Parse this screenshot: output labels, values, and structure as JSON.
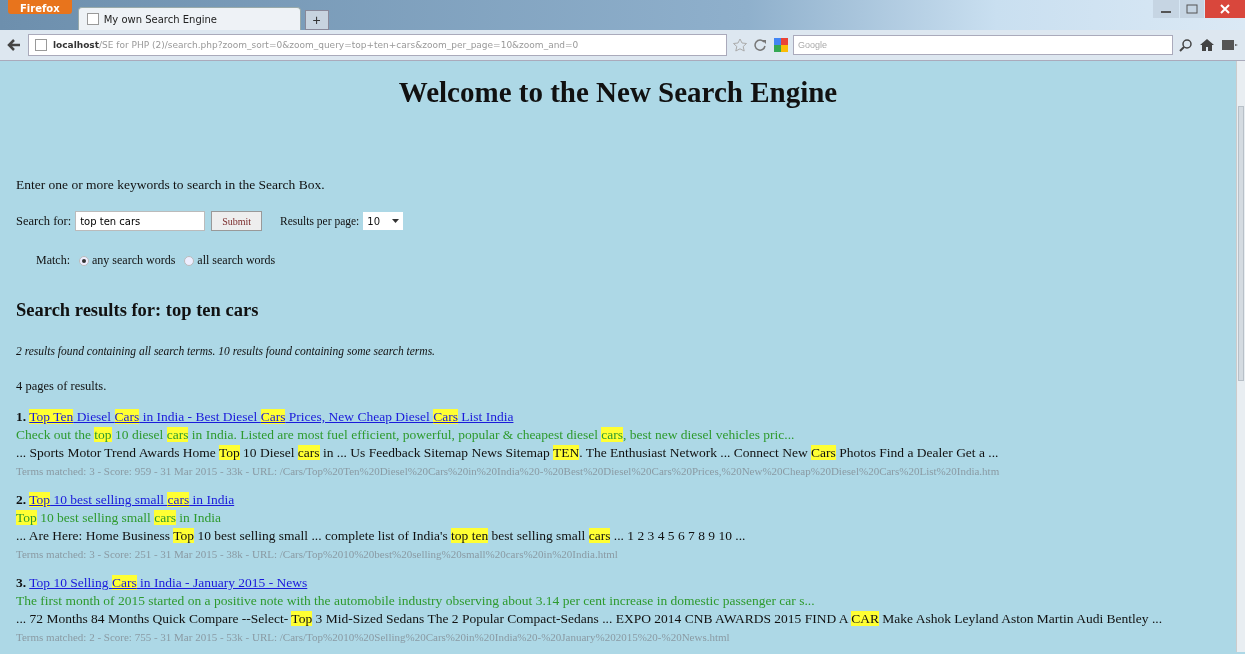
{
  "browser": {
    "menu_button": "Firefox",
    "tabs": [
      {
        "title": "My own Search Engine",
        "selected": true
      }
    ],
    "new_tab": "+",
    "address": "localhost/SE for PHP (2)/search.php?zoom_sort=0&zoom_query=top+ten+cars&zoom_per_page=10&zoom_and=0",
    "search_placeholder": "Google"
  },
  "page": {
    "heading": "Welcome to the New Search Engine",
    "intro": "Enter one or more keywords to search in the Search Box.",
    "search_label": "Search for:",
    "query": "top ten cars",
    "submit": "Submit",
    "per_page_label": "Results per page:",
    "per_page": "10",
    "match_label": "Match:",
    "match_options": [
      {
        "label": "any search words",
        "selected": true
      },
      {
        "label": "all search words",
        "selected": false
      }
    ],
    "results_heading": "Search results for: top ten cars",
    "summary": "2 results found containing all search terms. 10 results found containing some search terms.",
    "pages": "4 pages of results.",
    "results": [
      {
        "number": "1.",
        "title": [
          {
            "text": "Top Ten",
            "highlighted": true
          },
          {
            "text": " Diesel ",
            "highlighted": false
          },
          {
            "text": "Cars",
            "highlighted": true
          },
          {
            "text": " in India - Best Diesel ",
            "highlighted": false
          },
          {
            "text": "Cars",
            "highlighted": true
          },
          {
            "text": " Prices, New Cheap Diesel ",
            "highlighted": false
          },
          {
            "text": "Cars",
            "highlighted": true
          },
          {
            "text": " List India",
            "highlighted": false
          }
        ],
        "description": [
          {
            "text": "Check out the ",
            "highlighted": false
          },
          {
            "text": "top",
            "highlighted": true
          },
          {
            "text": " 10 diesel ",
            "highlighted": false
          },
          {
            "text": "cars",
            "highlighted": true
          },
          {
            "text": " in India. Listed are most fuel efficient, powerful, popular & cheapest diesel ",
            "highlighted": false
          },
          {
            "text": "cars",
            "highlighted": true
          },
          {
            "text": ", best new diesel vehicles pric...",
            "highlighted": false
          }
        ],
        "context": [
          {
            "text": "... Sports Motor Trend Awards Home ",
            "highlighted": false
          },
          {
            "text": "Top",
            "highlighted": true
          },
          {
            "text": " 10 Diesel ",
            "highlighted": false
          },
          {
            "text": "cars",
            "highlighted": true
          },
          {
            "text": " in ... Us Feedback Sitemap News Sitemap ",
            "highlighted": false
          },
          {
            "text": "TEN",
            "highlighted": true
          },
          {
            "text": ". The Enthusiast Network ... Connect New ",
            "highlighted": false
          },
          {
            "text": "Cars",
            "highlighted": true
          },
          {
            "text": " Photos Find a Dealer Get a ...",
            "highlighted": false
          }
        ],
        "info": "Terms matched: 3 - Score: 959 - 31 Mar 2015 - 33k - URL: /Cars/Top%20Ten%20Diesel%20Cars%20in%20India%20-%20Best%20Diesel%20Cars%20Prices,%20New%20Cheap%20Diesel%20Cars%20List%20India.htm"
      },
      {
        "number": "2.",
        "title": [
          {
            "text": "Top",
            "highlighted": true
          },
          {
            "text": " 10 best selling small ",
            "highlighted": false
          },
          {
            "text": "cars",
            "highlighted": true
          },
          {
            "text": " in India",
            "highlighted": false
          }
        ],
        "description": [
          {
            "text": "Top",
            "highlighted": true
          },
          {
            "text": " 10 best selling small ",
            "highlighted": false
          },
          {
            "text": "cars",
            "highlighted": true
          },
          {
            "text": " in India",
            "highlighted": false
          }
        ],
        "context": [
          {
            "text": "... Are Here: Home Business ",
            "highlighted": false
          },
          {
            "text": "Top",
            "highlighted": true
          },
          {
            "text": " 10 best selling small ... complete list of India's ",
            "highlighted": false
          },
          {
            "text": "top ten",
            "highlighted": true
          },
          {
            "text": " best selling small ",
            "highlighted": false
          },
          {
            "text": "cars",
            "highlighted": true
          },
          {
            "text": " ... 1 2 3 4 5 6 7 8 9 10 ...",
            "highlighted": false
          }
        ],
        "info": "Terms matched: 3 - Score: 251 - 31 Mar 2015 - 38k - URL: /Cars/Top%2010%20best%20selling%20small%20cars%20in%20India.html"
      },
      {
        "number": "3.",
        "title": [
          {
            "text": "Top 10 Selling ",
            "highlighted": false
          },
          {
            "text": "Cars",
            "highlighted": true
          },
          {
            "text": " in India - January 2015 - News",
            "highlighted": false
          }
        ],
        "description": [
          {
            "text": "The first month of 2015 started on a positive note with the automobile industry observing about 3.14 per cent increase in domestic passenger car s...",
            "highlighted": false
          }
        ],
        "context": [
          {
            "text": "... 72 Months 84 Months Quick Compare --Select- ",
            "highlighted": false
          },
          {
            "text": "Top",
            "highlighted": true
          },
          {
            "text": " 3 Mid-Sized Sedans The 2 Popular Compact-Sedans ... EXPO 2014 CNB AWARDS 2015 FIND A ",
            "highlighted": false
          },
          {
            "text": "CAR",
            "highlighted": true
          },
          {
            "text": " Make Ashok Leyland Aston Martin Audi Bentley ...",
            "highlighted": false
          }
        ],
        "info": "Terms matched: 2 - Score: 755 - 31 Mar 2015 - 53k - URL: /Cars/Top%2010%20Selling%20Cars%20in%20India%20-%20January%202015%20-%20News.html"
      }
    ]
  }
}
